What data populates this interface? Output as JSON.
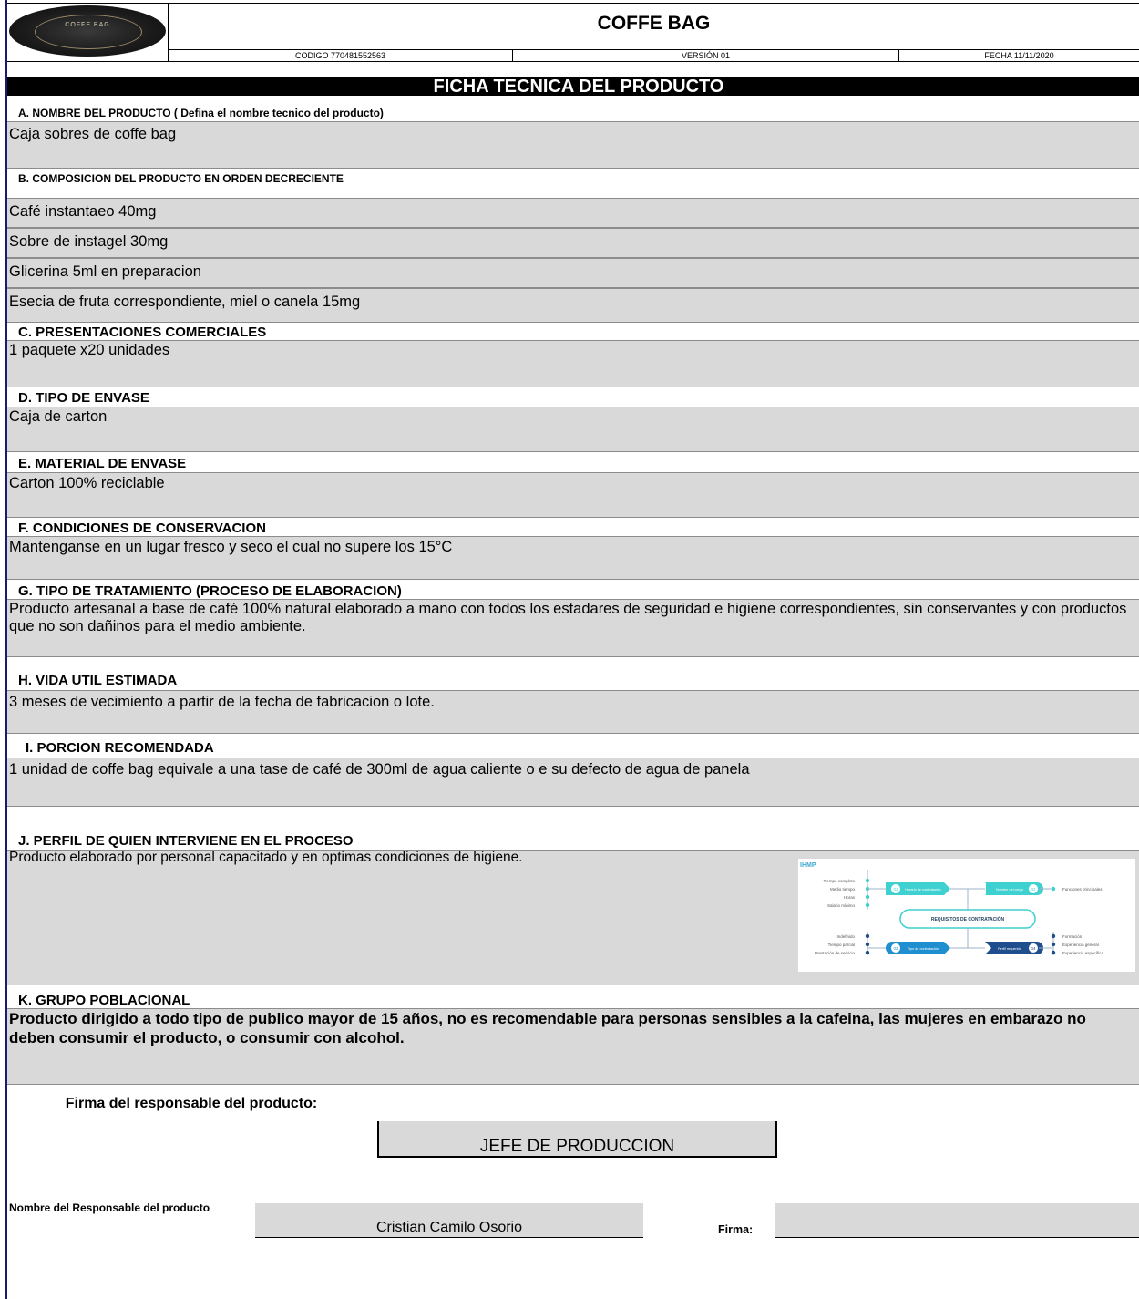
{
  "header": {
    "logo_text": "COFFE BAG",
    "title": "COFFE BAG",
    "codigo": "CODIGO 770481552563",
    "version": "VERSIÓN 01",
    "fecha": "FECHA 11/11/2020"
  },
  "banner": "FICHA TECNICA DEL PRODUCTO",
  "sections": {
    "a": {
      "label": "A. NOMBRE DEL PRODUCTO ( Defina el nombre tecnico del producto)",
      "value": "Caja sobres de coffe bag"
    },
    "b": {
      "label": "B. COMPOSICION DEL PRODUCTO EN ORDEN DECRECIENTE",
      "items": [
        "Café instantaeo  40mg",
        "Sobre de instagel 30mg",
        "Glicerina 5ml en preparacion",
        "Esecia de fruta correspondiente, miel o canela 15mg"
      ]
    },
    "c": {
      "label": "C. PRESENTACIONES COMERCIALES",
      "value": "1 paquete x20 unidades"
    },
    "d": {
      "label": "D. TIPO DE ENVASE",
      "value": "Caja de carton"
    },
    "e": {
      "label": "E. MATERIAL DE ENVASE",
      "value": "Carton 100% reciclable"
    },
    "f": {
      "label": "F. CONDICIONES DE CONSERVACION",
      "value": "Mantenganse en un lugar fresco y seco el cual no supere los 15°C"
    },
    "g": {
      "label": "G. TIPO DE TRATAMIENTO (PROCESO DE ELABORACION)",
      "value": "Producto artesanal a base de café 100% natural elaborado a mano con todos los estadares de seguridad e higiene correspondientes, sin conservantes y con productos que no son dañinos para el medio ambiente."
    },
    "h": {
      "label": "H. VIDA UTIL ESTIMADA",
      "value": "3 meses de vecimiento a partir de la fecha de fabricacion o lote."
    },
    "i": {
      "label": "I.  PORCION RECOMENDADA",
      "value": "1 unidad de coffe bag equivale a una tase de café de 300ml de agua caliente o e su defecto de agua de panela"
    },
    "j": {
      "label": "J.  PERFIL DE QUIEN INTERVIENE EN EL PROCESO",
      "value": "Producto elaborado por personal capacitado y en optimas condiciones de higiene."
    },
    "k": {
      "label": "K. GRUPO POBLACIONAL",
      "value": "Producto dirigido a todo tipo de publico mayor de 15 años, no es recomendable para personas sensibles a la cafeina, las mujeres en embarazo no deben consumir el producto, o consumir con alcohol."
    }
  },
  "infographic": {
    "brand": "IHMP",
    "center": "REQUISITOS DE CONTRATACIÓN",
    "left_top": [
      "Tiempo completo",
      "Medio tiempo",
      "Horas",
      "Salario mínimo"
    ],
    "left_bottom": [
      "Indefinido",
      "Tiempo parcial",
      "Prestación de servicio"
    ],
    "right_top": [
      "Funciones principales"
    ],
    "right_bottom": [
      "Formación",
      "Experiencia general",
      "Experiencia específica"
    ],
    "arrow_tl": "Horario de contratación",
    "arrow_tr": "Nombre del cargo",
    "arrow_bl": "Tipo de contratación",
    "arrow_br": "Perfil requerido",
    "num_tl": "01",
    "num_tr": "02",
    "num_bl": "03",
    "num_br": "04"
  },
  "signature": {
    "label": "Firma del responsable del producto:",
    "value": "JEFE DE PRODUCCION",
    "name_label": "Nombre  del  Responsable del producto",
    "name_value": "Cristian Camilo Osorio",
    "firma_label": "Firma:"
  },
  "colors": {
    "gray_cell": "#d9d9d9",
    "banner": "#000000",
    "teal": "#3fd0d0",
    "navy": "#1f4e8c"
  }
}
